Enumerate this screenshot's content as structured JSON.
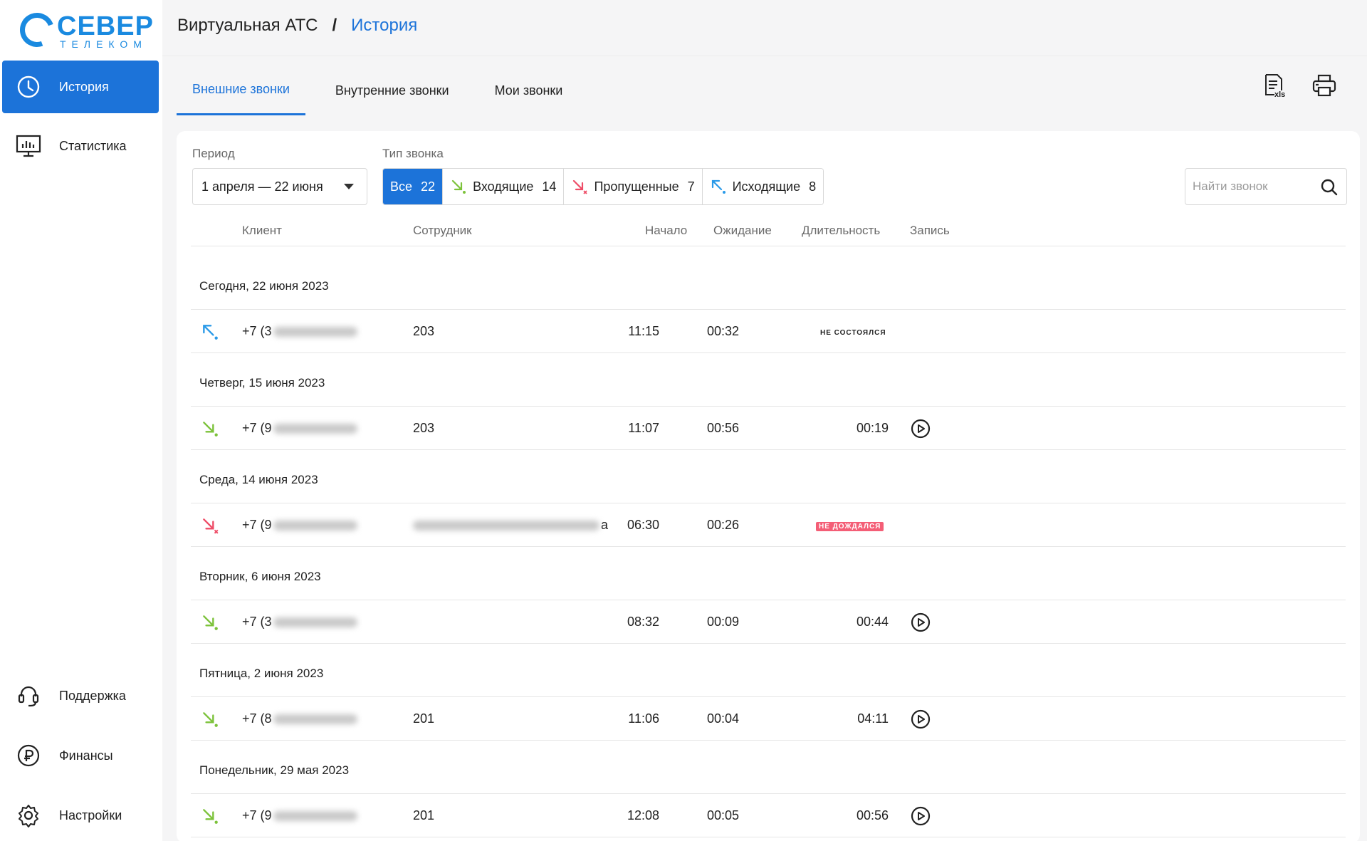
{
  "brand": {
    "name": "СЕВЕР",
    "sub": "ТЕЛЕКОМ",
    "color": "#1a8ae0"
  },
  "accent": "#1c73d9",
  "sidebar": {
    "items": [
      {
        "label": "История",
        "icon": "clock-icon",
        "active": true
      },
      {
        "label": "Статистика",
        "icon": "chart-monitor-icon"
      }
    ],
    "bottom_items": [
      {
        "label": "Поддержка",
        "icon": "headset-icon"
      },
      {
        "label": "Финансы",
        "icon": "ruble-icon"
      },
      {
        "label": "Настройки",
        "icon": "gear-icon"
      }
    ]
  },
  "header": {
    "root": "Виртуальная АТС",
    "separator": "/",
    "current": "История"
  },
  "tabs": [
    {
      "label": "Внешние звонки",
      "active": true
    },
    {
      "label": "Внутренние звонки"
    },
    {
      "label": "Мои звонки"
    }
  ],
  "actions": {
    "export_icon": "xls-export-icon",
    "print_icon": "printer-icon",
    "xls_text": "xls"
  },
  "filters": {
    "period_label": "Период",
    "period_value": "1 апреля — 22 июня",
    "type_label": "Тип звонка",
    "types": [
      {
        "label": "Все",
        "count": "22",
        "active": true
      },
      {
        "label": "Входящие",
        "count": "14",
        "icon": "incoming-icon",
        "color": "#7cc23a"
      },
      {
        "label": "Пропущенные",
        "count": "7",
        "icon": "missed-icon",
        "color": "#ee4d67"
      },
      {
        "label": "Исходящие",
        "count": "8",
        "icon": "outgoing-icon",
        "color": "#2a9ae8"
      }
    ],
    "search_placeholder": "Найти звонок"
  },
  "table": {
    "columns": [
      "Клиент",
      "Сотрудник",
      "Начало",
      "Ожидание",
      "Длительность",
      "Запись"
    ],
    "groups": [
      {
        "date": "Сегодня, 22 июня 2023",
        "row": {
          "direction": "outgoing",
          "client": "+7 (3",
          "employee": "203",
          "start": "11:15",
          "wait": "00:32",
          "duration": "",
          "status": "не состоялся",
          "record": false
        }
      },
      {
        "date": "Четверг, 15 июня 2023",
        "row": {
          "direction": "incoming",
          "client": "+7 (9",
          "employee": "203",
          "start": "11:07",
          "wait": "00:56",
          "duration": "00:19",
          "status": "",
          "record": true
        }
      },
      {
        "date": "Среда, 14 июня 2023",
        "row": {
          "direction": "missed",
          "client": "+7 (9",
          "employee": "а",
          "start": "06:30",
          "wait": "00:26",
          "duration": "",
          "status": "не дождался",
          "record": false
        }
      },
      {
        "date": "Вторник, 6 июня 2023",
        "row": {
          "direction": "incoming",
          "client": "+7 (3",
          "employee": "",
          "start": "08:32",
          "wait": "00:09",
          "duration": "00:44",
          "status": "",
          "record": true
        }
      },
      {
        "date": "Пятница, 2 июня 2023",
        "row": {
          "direction": "incoming",
          "client": "+7 (8",
          "employee": "201",
          "start": "11:06",
          "wait": "00:04",
          "duration": "04:11",
          "status": "",
          "record": true
        }
      },
      {
        "date": "Понедельник, 29 мая 2023",
        "row": {
          "direction": "incoming",
          "client": "+7 (9",
          "employee": "201",
          "start": "12:08",
          "wait": "00:05",
          "duration": "00:56",
          "status": "",
          "record": true
        }
      }
    ]
  }
}
